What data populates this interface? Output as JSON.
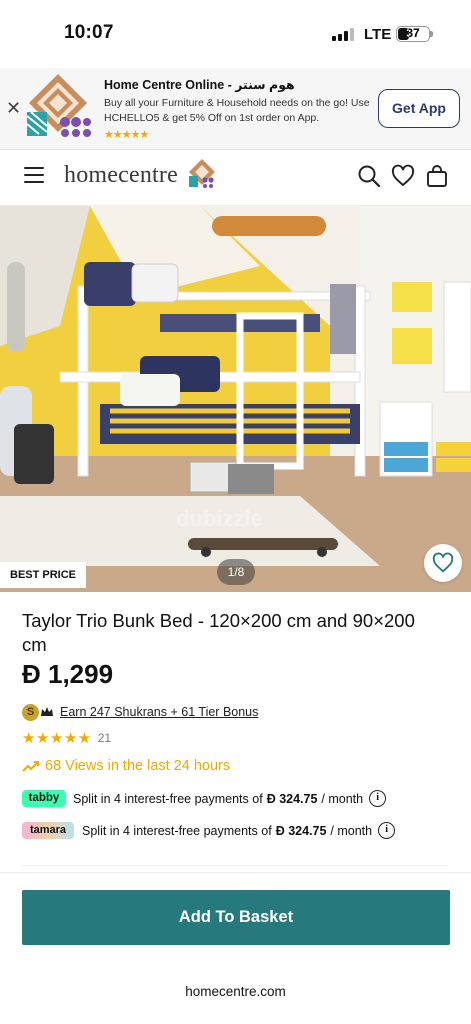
{
  "status_bar": {
    "time": "10:07",
    "network": "LTE",
    "battery": "37",
    "battery_level": 0.37
  },
  "app_banner": {
    "title": "Home Centre Online - هوم سنتر",
    "description": "Buy all your Furniture & Household needs on the go! Use HCHELLO5 & get 5% Off on 1st order on App.",
    "rating_stars": "★★★★★",
    "cta_label": "Get App",
    "close_icon": "close-icon"
  },
  "header": {
    "logo_text": "homecentre",
    "icons": [
      "menu-icon",
      "search-icon",
      "heart-icon",
      "shopping-bag-icon"
    ]
  },
  "hero": {
    "badge": "BEST PRICE",
    "pager": "1/8",
    "wishlist_icon": "heart-outline-icon",
    "watermark": "dubizzle"
  },
  "product": {
    "title": "Taylor Trio Bunk Bed - 120×200 cm and 90×200 cm",
    "price": "Ð 1,299",
    "shukran_badge": "S",
    "shukran_text": "Earn 247 Shukrans + 61  Tier Bonus",
    "stars": "★★★★★",
    "rating_value": 4.5,
    "review_count": "21",
    "views_text": "68 Views in the last 24 hours"
  },
  "payments": [
    {
      "provider": "tabby",
      "prefix": "Split in 4 interest-free payments of",
      "amount": "Ð 324.75",
      "suffix": "/ month"
    },
    {
      "provider": "tamara",
      "prefix": "Split in 4 interest-free payments of",
      "amount": "Ð 324.75",
      "suffix": "/ month"
    }
  ],
  "cta": {
    "add_to_basket": "Add To Basket"
  },
  "browser": {
    "url": "homecentre.com"
  },
  "colors": {
    "accent": "#267a7d",
    "star": "#f2a900",
    "banner_button": "#2e3a6b",
    "tabby": "#3bffb0"
  }
}
